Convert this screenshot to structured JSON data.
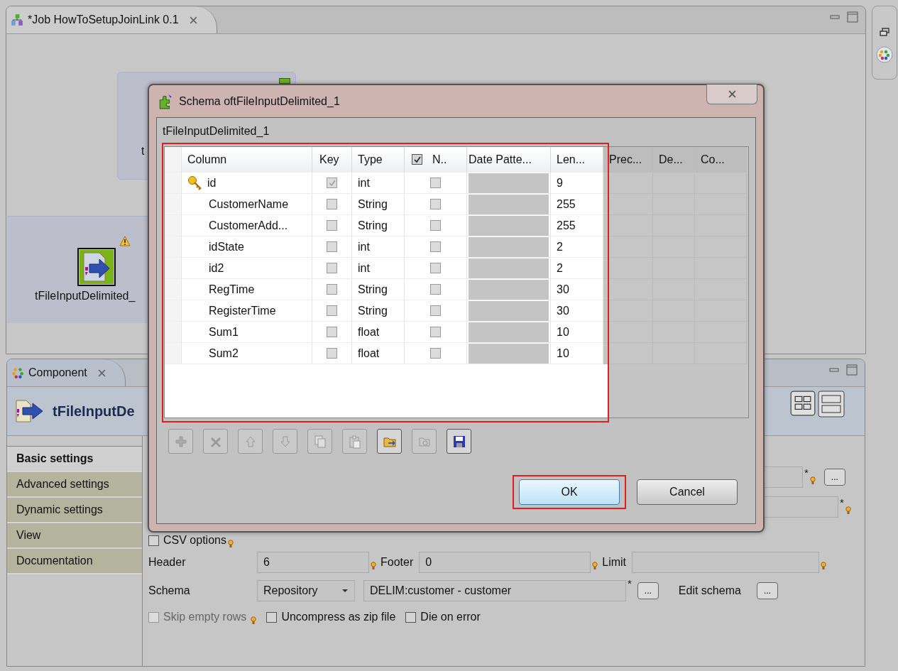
{
  "editor": {
    "tab": {
      "title": "*Job HowToSetupJoinLink 0.1"
    },
    "canvas": {
      "group_label": "t",
      "component": {
        "label": "tFileInputDelimited_",
        "selected": true,
        "warning": true
      }
    }
  },
  "component_panel": {
    "tab": {
      "title": "Component"
    },
    "header": "tFileInputDe",
    "side_tabs": [
      {
        "label": "Basic settings",
        "selected": true
      },
      {
        "label": "Advanced settings",
        "selected": false
      },
      {
        "label": "Dynamic settings",
        "selected": false
      },
      {
        "label": "View",
        "selected": false
      },
      {
        "label": "Documentation",
        "selected": false
      }
    ],
    "covered_fields": [
      {
        "required_mark": "*",
        "browse": "..."
      },
      {
        "required_mark": "*"
      }
    ],
    "csv_options": {
      "label": "CSV options",
      "checked": false
    },
    "limits": [
      {
        "label": "Header",
        "value": "6"
      },
      {
        "label": "Footer",
        "value": "0"
      },
      {
        "label": "Limit"
      }
    ],
    "schema": {
      "label": "Schema",
      "mode": "Repository",
      "value": "DELIM:customer - customer",
      "required_mark": "*",
      "browse": "...",
      "edit_label": "Edit schema",
      "edit_button": "..."
    },
    "options": [
      {
        "label": "Skip empty rows",
        "checked": false,
        "disabled": true,
        "hint": true
      },
      {
        "label": "Uncompress as zip file",
        "checked": false,
        "disabled": false,
        "hint": false
      },
      {
        "label": "Die on error",
        "checked": false,
        "disabled": false,
        "hint": false
      }
    ]
  },
  "dialog": {
    "title": "Schema oftFileInputDelimited_1",
    "subtitle": "tFileInputDelimited_1",
    "table": {
      "highlighted": true,
      "columns": [
        {
          "label": "Column"
        },
        {
          "label": "Key"
        },
        {
          "label": "Type"
        },
        {
          "label": "N..",
          "checked": true
        },
        {
          "label": "Date Patte..."
        },
        {
          "label": "Len..."
        },
        {
          "label": "Prec..."
        },
        {
          "label": "De..."
        },
        {
          "label": "Co..."
        }
      ],
      "rows": [
        {
          "key": true,
          "column": "id",
          "type": "int",
          "nullable": false,
          "length": "9"
        },
        {
          "key": false,
          "column": "CustomerName",
          "type": "String",
          "nullable": false,
          "length": "255"
        },
        {
          "key": false,
          "column": "CustomerAdd...",
          "type": "String",
          "nullable": false,
          "length": "255"
        },
        {
          "key": false,
          "column": "idState",
          "type": "int",
          "nullable": false,
          "length": "2"
        },
        {
          "key": false,
          "column": "id2",
          "type": "int",
          "nullable": false,
          "length": "2"
        },
        {
          "key": false,
          "column": "RegTime",
          "type": "String",
          "nullable": false,
          "length": "30"
        },
        {
          "key": false,
          "column": "RegisterTime",
          "type": "String",
          "nullable": false,
          "length": "30"
        },
        {
          "key": false,
          "column": "Sum1",
          "type": "float",
          "nullable": false,
          "length": "10"
        },
        {
          "key": false,
          "column": "Sum2",
          "type": "float",
          "nullable": false,
          "length": "10"
        }
      ]
    },
    "toolbar": [
      {
        "kind": "add",
        "disabled": true
      },
      {
        "kind": "remove",
        "disabled": true
      },
      {
        "kind": "up",
        "disabled": true
      },
      {
        "kind": "down",
        "disabled": true
      },
      {
        "kind": "copy",
        "disabled": true
      },
      {
        "kind": "paste",
        "disabled": true
      },
      {
        "kind": "import",
        "disabled": false
      },
      {
        "kind": "export",
        "disabled": true
      },
      {
        "kind": "save",
        "disabled": false
      }
    ],
    "buttons": [
      {
        "label": "OK",
        "default": true,
        "highlighted": true
      },
      {
        "label": "Cancel",
        "default": false,
        "highlighted": false
      }
    ]
  }
}
